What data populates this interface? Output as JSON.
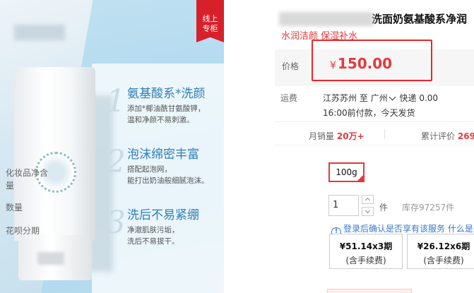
{
  "image": {
    "badge": [
      "线上",
      "专柜"
    ],
    "features": [
      {
        "num": "1",
        "title": "氨基酸系*洗颜",
        "desc": [
          "添加*椰油酰甘氨酸钾，",
          "温和净颜不易刺激。"
        ]
      },
      {
        "num": "2",
        "title": "泡沫绵密丰富",
        "desc": [
          "搭配起泡网，",
          "能打出奶油般细腻泡沫。"
        ]
      },
      {
        "num": "3",
        "title": "洗后不易紧绷",
        "desc": [
          "净澈肌肤污垢，",
          "洗后不易拔干。"
        ]
      }
    ]
  },
  "product": {
    "title": "洗面奶氨基酸系净润",
    "subtitle": "水润洁颜 保湿补水",
    "price_label": "价格",
    "currency": "¥",
    "price": "150.00",
    "shipping_label": "运费",
    "ship_from": "江苏苏州",
    "to_label": "至",
    "ship_to": "广州",
    "express": "快递 0.00",
    "delivery_note": "16:00前付款，今天发货",
    "monthly_sales_label": "月销量",
    "monthly_sales": "20万+",
    "reviews_label": "累计评价",
    "reviews": "269",
    "spec_label": "化妆品净含量",
    "spec_option": "100g",
    "qty_label": "数量",
    "qty_value": "1",
    "qty_unit": "件",
    "stock": "库存97257件",
    "huabei_label": "花呗分期",
    "huabei_note": "登录后确认是否享有该服务 什么是",
    "plans": [
      {
        "amount": "¥51.14x3期",
        "fee": "(含手续费)"
      },
      {
        "amount": "¥26.12x6期",
        "fee": "(含手续费)"
      }
    ]
  },
  "colors": {
    "accent": "#e4393c",
    "highlight": "#e8262b",
    "link": "#3a77c7"
  }
}
